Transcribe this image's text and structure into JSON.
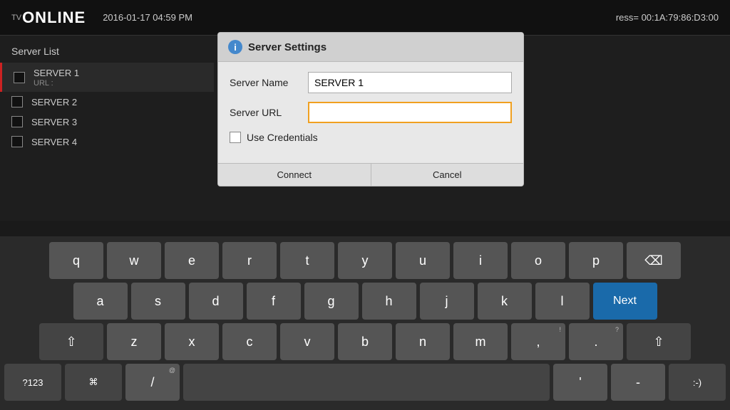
{
  "header": {
    "logo_tv": "TV",
    "logo_online": "ONLINE",
    "datetime": "2016-01-17 04:59 PM",
    "mac_label": "ress= 00:1A:79:86:D3:00"
  },
  "server_list": {
    "title": "Server List",
    "items": [
      {
        "name": "SERVER 1",
        "url_label": "URL :",
        "active": true
      },
      {
        "name": "SERVER 2",
        "url_label": "",
        "active": false
      },
      {
        "name": "SERVER 3",
        "url_label": "",
        "active": false
      },
      {
        "name": "SERVER 4",
        "url_label": "",
        "active": false
      }
    ]
  },
  "dialog": {
    "title": "Server Settings",
    "server_name_label": "Server Name",
    "server_name_value": "SERVER 1",
    "server_url_label": "Server URL",
    "server_url_value": "",
    "use_credentials_label": "Use Credentials",
    "connect_btn": "Connect",
    "cancel_btn": "Cancel"
  },
  "keyboard": {
    "rows": [
      [
        "q",
        "w",
        "e",
        "r",
        "t",
        "y",
        "u",
        "i",
        "o",
        "p"
      ],
      [
        "a",
        "s",
        "d",
        "f",
        "g",
        "h",
        "j",
        "k",
        "l"
      ],
      [
        "z",
        "x",
        "c",
        "v",
        "b",
        "n",
        "m",
        ",",
        "."
      ]
    ],
    "next_label": "Next",
    "special_labels": {
      "numbers": "?123",
      "symbol": "⌘",
      "slash": "/",
      "smiley": ":-)",
      "dash": "-",
      "apostrophe": "'",
      "comma_sup": "!",
      "period_sup": "?"
    }
  }
}
